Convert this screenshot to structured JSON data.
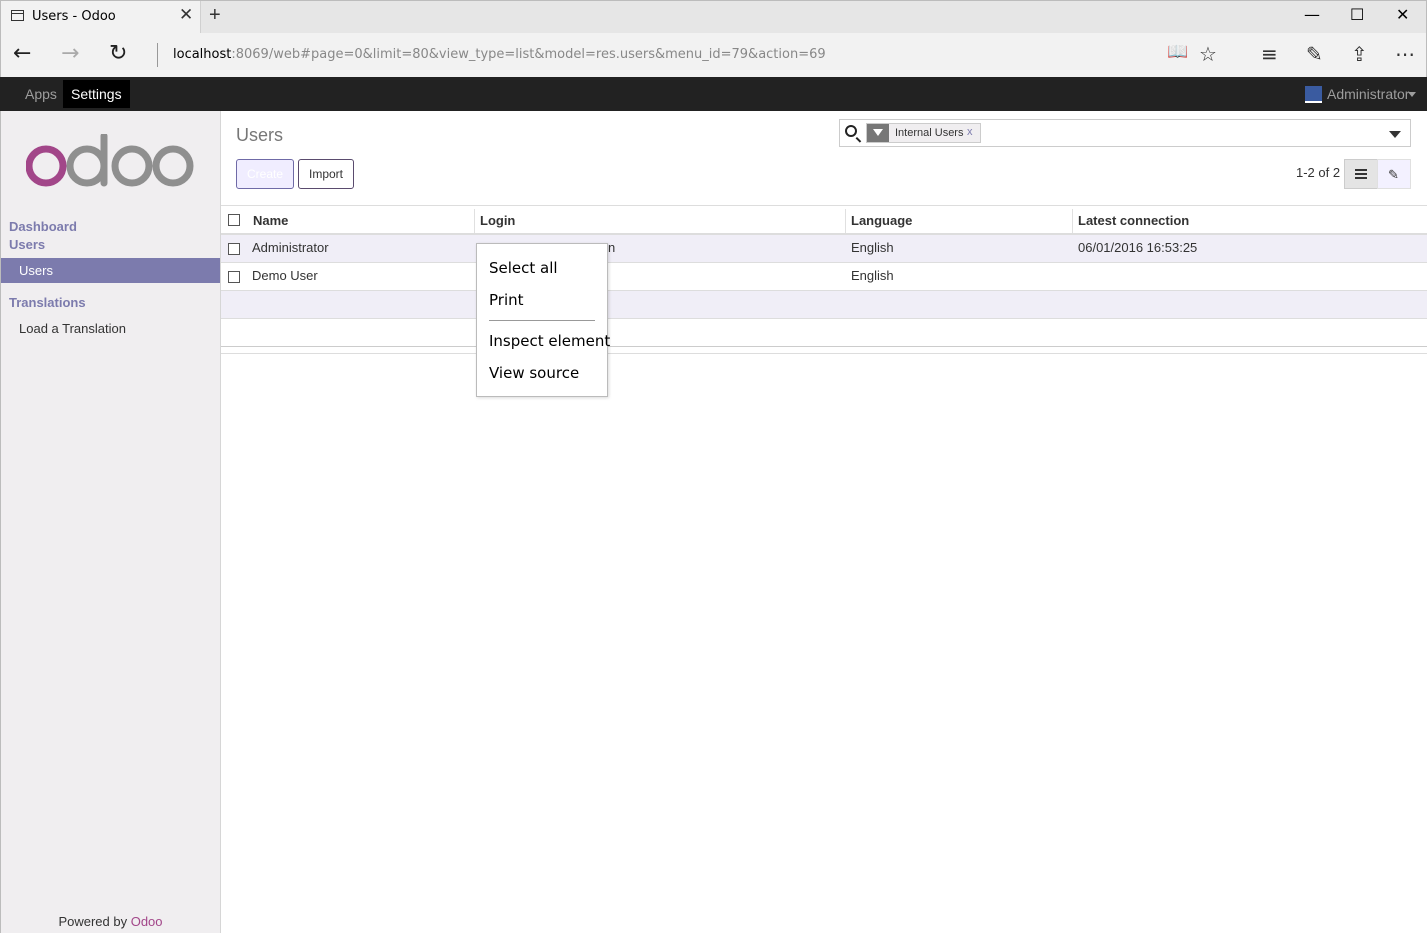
{
  "browser": {
    "tab_title": "Users - Odoo",
    "tab_close": "✕",
    "new_tab": "+",
    "url_host": "localhost",
    "url_rest": ":8069/web#page=0&limit=80&view_type=list&model=res.users&menu_id=79&action=69",
    "minimize": "—",
    "maximize": "☐",
    "close": "✕",
    "back": "←",
    "forward": "→",
    "refresh": "↻",
    "reading_view": "📖",
    "favorite": "☆",
    "hub": "≡",
    "note": "✎",
    "share": "⇪",
    "more": "⋯"
  },
  "topbar": {
    "apps": "Apps",
    "settings": "Settings",
    "user": "Administrator"
  },
  "sidebar": {
    "dashboard": "Dashboard",
    "users_section": "Users",
    "users_item": "Users",
    "translations_section": "Translations",
    "load_translation": "Load a Translation",
    "powered_prefix": "Powered by ",
    "powered_brand": "Odoo",
    "logo": "odoo"
  },
  "control": {
    "title": "Users",
    "create": "Create",
    "import": "Import",
    "facet": "Internal Users",
    "facet_remove": "x",
    "pager": "1-2 of 2"
  },
  "table": {
    "headers": [
      "Name",
      "Login",
      "Language",
      "Latest connection"
    ],
    "rows": [
      {
        "name": "Administrator",
        "login": "n",
        "language": "English",
        "latest": "06/01/2016 16:53:25"
      },
      {
        "name": "Demo User",
        "login": "",
        "language": "English",
        "latest": ""
      }
    ]
  },
  "context_menu": {
    "items": [
      "Select all",
      "Print",
      "Inspect element",
      "View source"
    ]
  },
  "colors": {
    "brand_purple": "#7c7bad",
    "odoo_magenta": "#a24689",
    "topbar": "#222222"
  }
}
